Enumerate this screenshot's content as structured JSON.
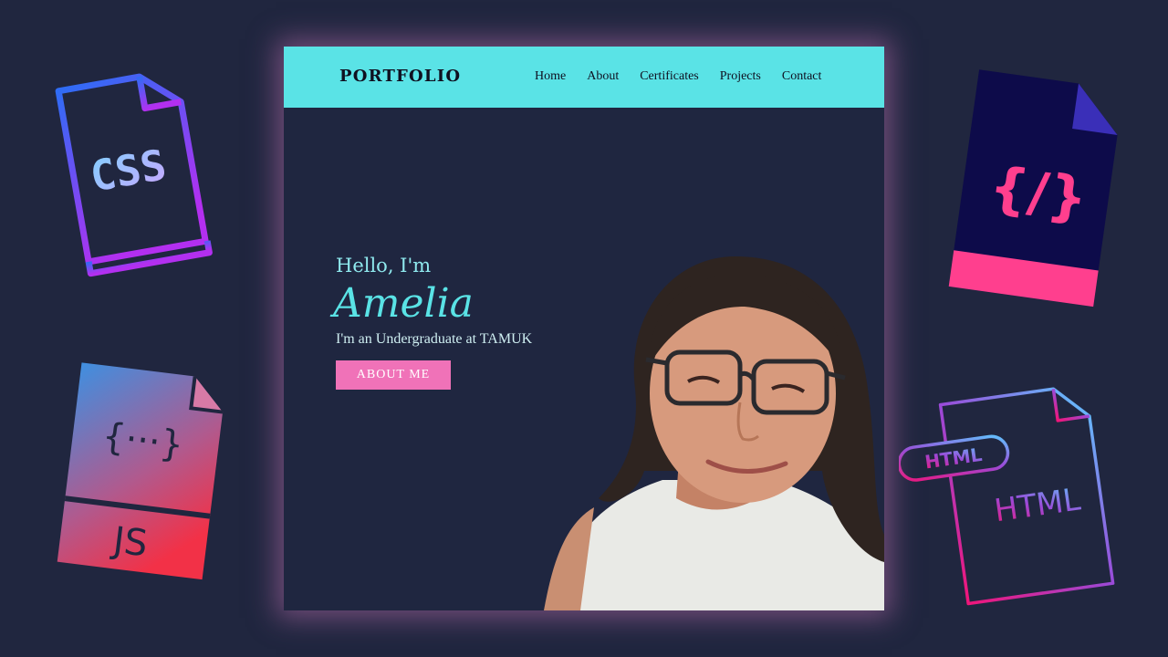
{
  "nav": {
    "brand": "PORTFOLIO",
    "links": [
      "Home",
      "About",
      "Certificates",
      "Projects",
      "Contact"
    ]
  },
  "hero": {
    "greeting": "Hello, I'm",
    "name": "Amelia",
    "tagline": "I'm an Undergraduate at TAMUK",
    "button_label": "ABOUT ME"
  },
  "decorations": {
    "css_file": {
      "icon": "css-file-icon",
      "label": "CSS"
    },
    "js_file": {
      "icon": "js-file-icon",
      "braces": "{···}",
      "label": "JS"
    },
    "code_file": {
      "icon": "code-file-icon",
      "glyph": "{/}"
    },
    "html_file": {
      "icon": "html-file-icon",
      "tag_label": "HTML",
      "label": "HTML"
    }
  },
  "colors": {
    "page_background": "#20263f",
    "nav_background": "#5ae3e6",
    "hero_background": "#1f2640",
    "accent_cyan": "#5ae3e6",
    "button_pink": "#f072b8",
    "glow": "#b56caa"
  }
}
